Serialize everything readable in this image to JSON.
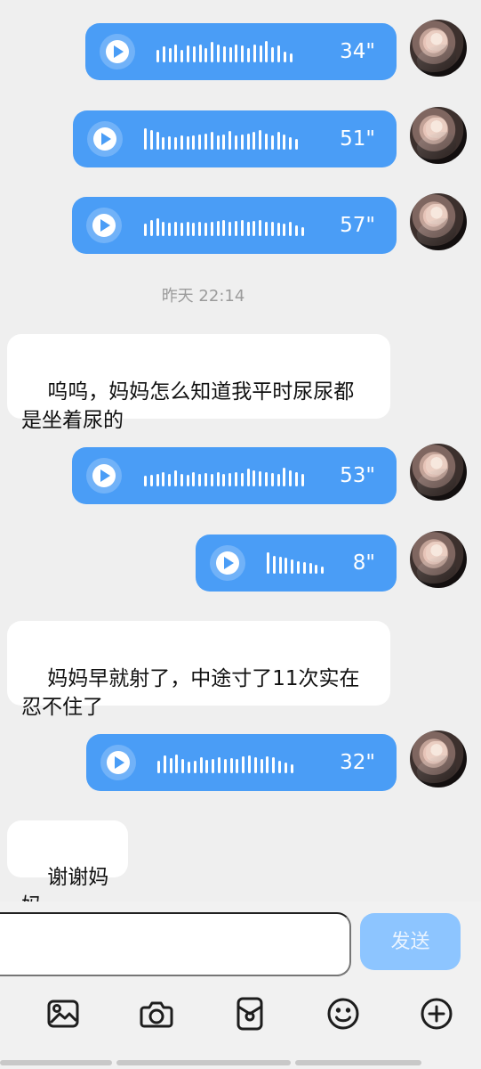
{
  "messages": {
    "voice_1_duration": "34\"",
    "voice_2_duration": "51\"",
    "voice_3_duration": "57\"",
    "timestamp": "昨天 22:14",
    "incoming_1": "呜呜，妈妈怎么知道我平时尿尿都\n是坐着尿的",
    "voice_4_duration": "53\"",
    "voice_5_duration": "8\"",
    "incoming_2": "妈妈早就射了，中途寸了11次实在\n忍不住了",
    "voice_6_duration": "32\"",
    "incoming_3": "谢谢妈妈"
  },
  "composer": {
    "input_placeholder": "",
    "send_label": "发送"
  },
  "toolbar": {
    "icons": [
      "image-icon",
      "camera-icon",
      "red-packet-icon",
      "emoji-icon",
      "plus-icon"
    ]
  },
  "colors": {
    "voice_bubble": "#4a9df6",
    "incoming_bubble": "#ffffff",
    "background": "#efefef",
    "send_button": "#8dc5ff",
    "timestamp_text": "#9b9b9b"
  }
}
